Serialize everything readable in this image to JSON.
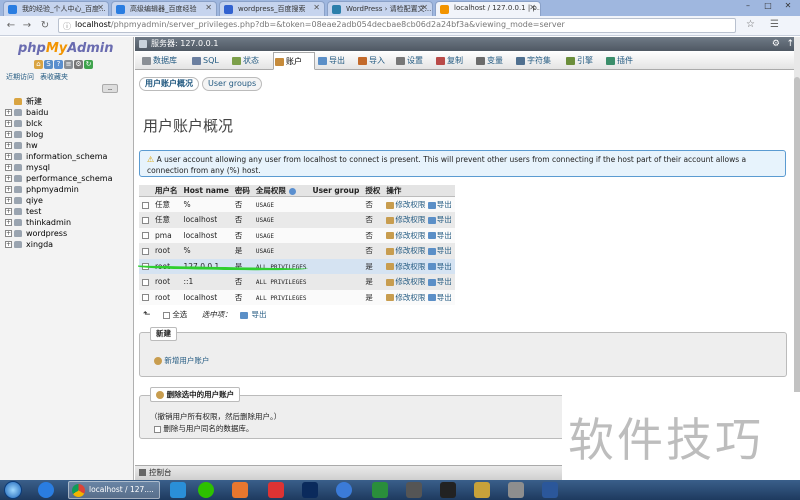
{
  "browser": {
    "tabs": [
      {
        "label": "我的经验_个人中心_百度...",
        "icon_color": "#2a7de1",
        "active": false
      },
      {
        "label": "高级编辑器_百度经验",
        "icon_color": "#2a7de1",
        "active": false
      },
      {
        "label": "wordpress_百度搜索",
        "icon_color": "#3262d0",
        "active": false
      },
      {
        "label": "WordPress › 请检配置文...",
        "icon_color": "#2b7fab",
        "active": false
      },
      {
        "label": "localhost / 127.0.0.1 | p...",
        "icon_color": "#f29400",
        "active": true
      }
    ],
    "url_host": "localhost",
    "url_path": "/phpmyadmin/server_privileges.php?db=&token=08eae2adb054decbae8cb06d2a24bf3a&viewing_mode=server"
  },
  "nav": {
    "logo_php": "php",
    "logo_my": "My",
    "logo_admin": "Admin",
    "icons": [
      "home-icon",
      "sql-icon",
      "help-icon",
      "docs-icon",
      "settings-icon",
      "refresh-icon"
    ],
    "link_recent": "近期访问",
    "link_favorites": "表收藏夹",
    "collapse_label": "--",
    "databases": [
      "新建",
      "baidu",
      "blck",
      "blog",
      "hw",
      "information_schema",
      "mysql",
      "performance_schema",
      "phpmyadmin",
      "qiye",
      "test",
      "thinkadmin",
      "wordpress",
      "xingda"
    ]
  },
  "server": {
    "breadcrumb": "服务器: 127.0.0.1"
  },
  "menu": {
    "tabs": [
      {
        "label": "数据库",
        "color": "#8a8f95"
      },
      {
        "label": "SQL",
        "color": "#6b7fa0"
      },
      {
        "label": "状态",
        "color": "#7c9f4a"
      },
      {
        "label": "账户",
        "color": "#c68b3b"
      },
      {
        "label": "导出",
        "color": "#5b8fc7"
      },
      {
        "label": "导入",
        "color": "#c36a2b"
      },
      {
        "label": "设置",
        "color": "#777777"
      },
      {
        "label": "复制",
        "color": "#b94a48"
      },
      {
        "label": "变量",
        "color": "#6b6b6b"
      },
      {
        "label": "字符集",
        "color": "#4f6f8f"
      },
      {
        "label": "引擎",
        "color": "#6b8e3b"
      },
      {
        "label": "插件",
        "color": "#3b8e6b"
      }
    ],
    "active_index": 3
  },
  "subtabs": [
    "用户账户概况",
    "User groups"
  ],
  "page_title": "用户账户概况",
  "notice": "A user account allowing any user from localhost to connect is present. This will prevent other users from connecting if the host part of their account allows a connection from any (%) host.",
  "table": {
    "headers": [
      "用户名",
      "Host name",
      "密码",
      "全局权限",
      "User group",
      "授权",
      "操作"
    ],
    "rows": [
      {
        "user": "任意",
        "host": "%",
        "password": "否",
        "privileges": "USAGE",
        "group": "",
        "grant": "否",
        "edit": "修改权限",
        "export": "导出",
        "any_user": true
      },
      {
        "user": "任意",
        "host": "localhost",
        "password": "否",
        "privileges": "USAGE",
        "group": "",
        "grant": "否",
        "edit": "修改权限",
        "export": "导出",
        "any_user": true
      },
      {
        "user": "pma",
        "host": "localhost",
        "password": "否",
        "privileges": "USAGE",
        "group": "",
        "grant": "否",
        "edit": "修改权限",
        "export": "导出",
        "any_user": false
      },
      {
        "user": "root",
        "host": "%",
        "password": "是",
        "privileges": "USAGE",
        "group": "",
        "grant": "否",
        "edit": "修改权限",
        "export": "导出",
        "any_user": false
      },
      {
        "user": "root",
        "host": "127.0.0.1",
        "password": "是",
        "privileges": "ALL PRIVILEGES",
        "group": "",
        "grant": "是",
        "edit": "修改权限",
        "export": "导出",
        "any_user": false
      },
      {
        "user": "root",
        "host": "::1",
        "password": "否",
        "privileges": "ALL PRIVILEGES",
        "group": "",
        "grant": "是",
        "edit": "修改权限",
        "export": "导出",
        "any_user": false
      },
      {
        "user": "root",
        "host": "localhost",
        "password": "否",
        "privileges": "ALL PRIVILEGES",
        "group": "",
        "grant": "是",
        "edit": "修改权限",
        "export": "导出",
        "any_user": false
      }
    ],
    "highlighted_row": 4
  },
  "bulk": {
    "select_all": "全选",
    "selected_label": "选中项：",
    "export": "导出"
  },
  "new_section": {
    "legend": "新建",
    "add_user": "新增用户账户"
  },
  "delete_section": {
    "legend": "删除选中的用户账户",
    "note": "（撤销用户所有权限，然后删除用户。）",
    "drop_db": "删除与用户同名的数据库。"
  },
  "console": "控制台",
  "watermark": "软件技巧",
  "taskbar": {
    "chrome_label": "localhost / 127...."
  }
}
